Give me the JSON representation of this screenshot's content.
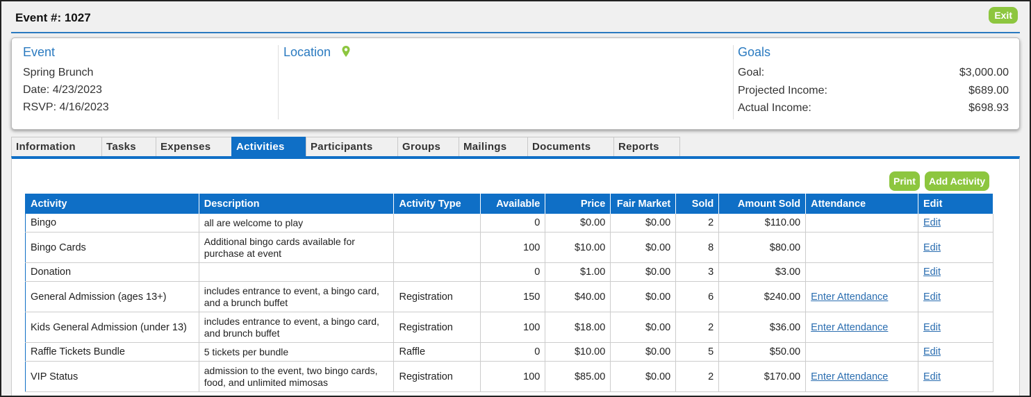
{
  "header": {
    "title": "Event #: 1027",
    "exit_label": "Exit"
  },
  "event": {
    "heading": "Event",
    "name": "Spring Brunch",
    "date": "Date: 4/23/2023",
    "rsvp": "RSVP: 4/16/2023"
  },
  "location": {
    "heading": "Location",
    "pin_icon": "map-pin-icon"
  },
  "goals": {
    "heading": "Goals",
    "rows": [
      {
        "label": "Goal:",
        "value": "$3,000.00"
      },
      {
        "label": "Projected Income:",
        "value": "$689.00"
      },
      {
        "label": "Actual Income:",
        "value": "$698.93"
      }
    ]
  },
  "tabs": [
    {
      "label": "Information"
    },
    {
      "label": "Tasks"
    },
    {
      "label": "Expenses"
    },
    {
      "label": "Activities",
      "active": true
    },
    {
      "label": "Participants"
    },
    {
      "label": "Groups"
    },
    {
      "label": "Mailings"
    },
    {
      "label": "Documents"
    },
    {
      "label": "Reports"
    }
  ],
  "toolbar": {
    "print_label": "Print",
    "add_label": "Add Activity"
  },
  "table": {
    "headers": [
      "Activity",
      "Description",
      "Activity Type",
      "Available",
      "Price",
      "Fair Market",
      "Sold",
      "Amount Sold",
      "Attendance",
      "Edit"
    ],
    "rows": [
      [
        "Bingo",
        "all are welcome to play",
        "",
        "0",
        "$0.00",
        "$0.00",
        "2",
        "$110.00",
        "",
        "Edit"
      ],
      [
        "Bingo Cards",
        "Additional bingo cards available for purchase at event",
        "",
        "100",
        "$10.00",
        "$0.00",
        "8",
        "$80.00",
        "",
        "Edit"
      ],
      [
        "Donation",
        "",
        "",
        "0",
        "$1.00",
        "$0.00",
        "3",
        "$3.00",
        "",
        "Edit"
      ],
      [
        "General Admission (ages 13+)",
        "includes entrance to event, a bingo card, and a brunch buffet",
        "Registration",
        "150",
        "$40.00",
        "$0.00",
        "6",
        "$240.00",
        "Enter Attendance",
        "Edit"
      ],
      [
        "Kids General Admission (under 13)",
        "includes entrance to event, a bingo card, and brunch buffet",
        "Registration",
        "100",
        "$18.00",
        "$0.00",
        "2",
        "$36.00",
        "Enter Attendance",
        "Edit"
      ],
      [
        "Raffle Tickets Bundle",
        "5 tickets per bundle",
        "Raffle",
        "0",
        "$10.00",
        "$0.00",
        "5",
        "$50.00",
        "",
        "Edit"
      ],
      [
        "VIP Status",
        "admission to the event, two bingo cards, food, and unlimited mimosas",
        "Registration",
        "100",
        "$85.00",
        "$0.00",
        "2",
        "$170.00",
        "Enter Attendance",
        "Edit"
      ]
    ]
  },
  "colors": {
    "accent": "#0f6fc6",
    "button_green": "#8dc63f",
    "heading_blue": "#2a7ac0"
  }
}
